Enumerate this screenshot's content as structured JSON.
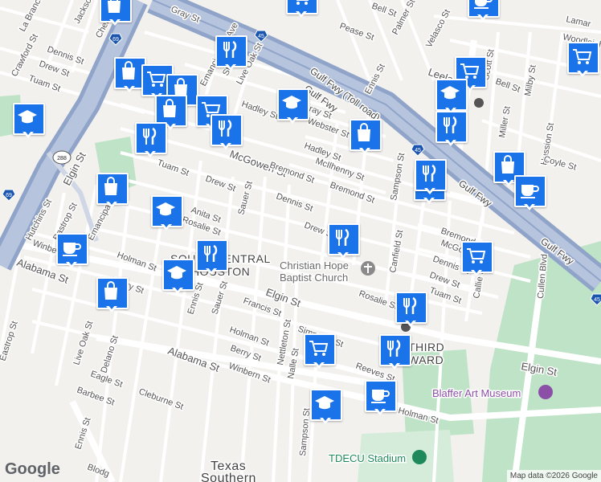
{
  "map": {
    "attribution": "Map data ©2026 Google",
    "logo": "Google"
  },
  "labels": {
    "gray_st": "Gray St",
    "pease_st": "Pease St",
    "bell_st_top": "Bell St",
    "palmer_st": "Palmer St",
    "velasco_st": "Velasco St",
    "lamar": "Lamar",
    "woodleigh": "Woodleigh",
    "la_branch": "La Branch",
    "jackson": "Jackson",
    "chenevert": "Chenevert",
    "crawford_st": "Crawford St",
    "dennis_st_w": "Dennis St",
    "drew_st_w": "Drew St",
    "tuam_st_w": "Tuam St",
    "live_oak_st_n": "Live Oak St",
    "emancipation_ave_n": "Emancipation Ave",
    "st_charles": "St Charles",
    "hadley_st": "Hadley St",
    "gulf_fwy_toll": "Gulf Fwy (Toll road)",
    "gulf_fwy": "Gulf Fwy",
    "gray_st_mid": "Gray St",
    "webster_st": "Webster St",
    "ennis_st_n": "Ennis St",
    "leeland": "Leeland",
    "scott_st": "Scott St",
    "bell_st": "Bell St",
    "milby_st": "Milby St",
    "miller_st": "Miller St",
    "hussion_st": "Hussion St",
    "coyle_st": "Coyle St",
    "mcgowen_st": "McGowen St",
    "bremond_st_1": "Bremond St",
    "mcilhenny_st": "McIlhenny St",
    "hadley_st_2": "Hadley St",
    "bremond_st_2": "Bremond St",
    "sampson_st_n": "Sampson St",
    "gulf_fwy_se": "Gulf Fwy",
    "gulf_fwy_se2": "Gulf Fwy",
    "elgin_st_w": "Elgin St",
    "tuam_st_mid": "Tuam St",
    "drew_st_mid": "Drew St",
    "sauer_st": "Sauer St",
    "dennis_st_mid": "Dennis St",
    "drew_st_e": "Drew St",
    "anita_st": "Anita St",
    "rosalie_st_w": "Rosalie St",
    "hutchins_st": "Hutchins St",
    "bastrop_st": "Bastrop St",
    "emancipation_ave": "Emancipation Ave",
    "winbern_st_w": "Winbern St",
    "holman_st_w": "Holman St",
    "alabama_st_w": "Alabama St",
    "berry_st_w": "Berry St",
    "canfield_st": "Canfield St",
    "bremond_st_3": "Bremond St",
    "mcgowen_st_e": "McGowen St",
    "dennis_st_e": "Dennis St",
    "drew_st_e2": "Drew St",
    "tuam_st_e": "Tuam St",
    "callie_st": "Callie St",
    "cullen_blvd": "Cullen Blvd",
    "south_central_1": "SOUTH CENTRAL",
    "south_central_2": "HOUSTON",
    "christian_hope_1": "Christian Hope",
    "christian_hope_2": "Baptist Church",
    "rosalie_st_e": "Rosalie St",
    "francis_st": "Francis St",
    "elgin_st_mid": "Elgin St",
    "sauer_st_s": "Sauer St",
    "ennis_st": "Ennis St",
    "live_oak_st": "Live Oak St",
    "delano_st": "Delano St",
    "eastrop_st": "Eastrop St",
    "holman_st_mid": "Holman St",
    "berry_st_mid": "Berry St",
    "winbern_st_mid": "Winbern St",
    "nettleton_st": "Nettleton St",
    "nalle_st": "Nalle St",
    "simmons_st": "Simmons St",
    "alabama_st": "Alabama St",
    "eagle_st": "Eagle St",
    "barbee_st": "Barbee St",
    "cleburne_st": "Cleburne St",
    "ennis_st_s": "Ennis St",
    "blodgett": "Blodg",
    "reeves_st": "Reeves St",
    "third_ward_1": "THIRD",
    "third_ward_2": "WARD",
    "elgin_st_e": "Elgin St",
    "blaffer": "Blaffer Art Museum",
    "holman_st_e": "Holman St",
    "sampson_st_s": "Sampson St",
    "tdecu": "TDECU Stadium",
    "texas_southern_1": "Texas",
    "texas_southern_2": "Southern"
  },
  "shields": {
    "i69_a": "69",
    "i69_b": "69",
    "i45_a": "45",
    "i45_b": "45",
    "i45_c": "45",
    "us288": "288"
  },
  "markers": [
    {
      "name": "shopping-marker-1",
      "icon": "shopping-bag-icon"
    },
    {
      "name": "shopping-cart-marker-1",
      "icon": "shopping-cart-icon"
    },
    {
      "name": "coffee-marker-1",
      "icon": "coffee-cup-icon"
    },
    {
      "name": "shopping-cart-marker-2",
      "icon": "shopping-cart-icon"
    },
    {
      "name": "restaurant-marker-1",
      "icon": "fork-knife-icon"
    },
    {
      "name": "shopping-bag-marker-2",
      "icon": "shopping-bag-icon"
    },
    {
      "name": "shopping-cart-marker-3",
      "icon": "shopping-cart-icon"
    },
    {
      "name": "shopping-bag-marker-3",
      "icon": "shopping-bag-icon"
    },
    {
      "name": "school-marker-1",
      "icon": "graduation-cap-icon"
    },
    {
      "name": "shopping-cart-marker-4",
      "icon": "shopping-cart-icon"
    },
    {
      "name": "school-marker-2",
      "icon": "graduation-cap-icon"
    },
    {
      "name": "restaurant-marker-2",
      "icon": "fork-knife-icon"
    },
    {
      "name": "shopping-bag-marker-4",
      "icon": "shopping-bag-icon"
    },
    {
      "name": "school-marker-3",
      "icon": "graduation-cap-icon"
    },
    {
      "name": "restaurant-marker-3",
      "icon": "fork-knife-icon"
    },
    {
      "name": "restaurant-marker-4",
      "icon": "fork-knife-icon"
    },
    {
      "name": "shopping-bag-marker-5",
      "icon": "shopping-bag-icon"
    },
    {
      "name": "restaurant-marker-5",
      "icon": "fork-knife-icon"
    },
    {
      "name": "shopping-cart-marker-5",
      "icon": "shopping-cart-icon"
    },
    {
      "name": "restaurant-marker-6",
      "icon": "fork-knife-icon"
    },
    {
      "name": "shopping-bag-marker-6",
      "icon": "shopping-bag-icon"
    },
    {
      "name": "coffee-marker-2",
      "icon": "coffee-cup-icon"
    },
    {
      "name": "school-marker-4",
      "icon": "graduation-cap-icon"
    },
    {
      "name": "shopping-bag-marker-7",
      "icon": "shopping-bag-icon"
    },
    {
      "name": "coffee-marker-3",
      "icon": "coffee-cup-icon"
    },
    {
      "name": "restaurant-marker-7",
      "icon": "fork-knife-icon"
    },
    {
      "name": "shopping-cart-marker-6",
      "icon": "shopping-cart-icon"
    },
    {
      "name": "school-marker-5",
      "icon": "graduation-cap-icon"
    },
    {
      "name": "shopping-bag-marker-8",
      "icon": "shopping-bag-icon"
    },
    {
      "name": "restaurant-marker-8",
      "icon": "fork-knife-icon"
    },
    {
      "name": "shopping-cart-marker-7",
      "icon": "shopping-cart-icon"
    },
    {
      "name": "restaurant-marker-9",
      "icon": "fork-knife-icon"
    },
    {
      "name": "school-marker-6",
      "icon": "graduation-cap-icon"
    },
    {
      "name": "coffee-marker-4",
      "icon": "coffee-cup-icon"
    },
    {
      "name": "coffee-marker-5",
      "icon": "coffee-cup-icon"
    }
  ]
}
